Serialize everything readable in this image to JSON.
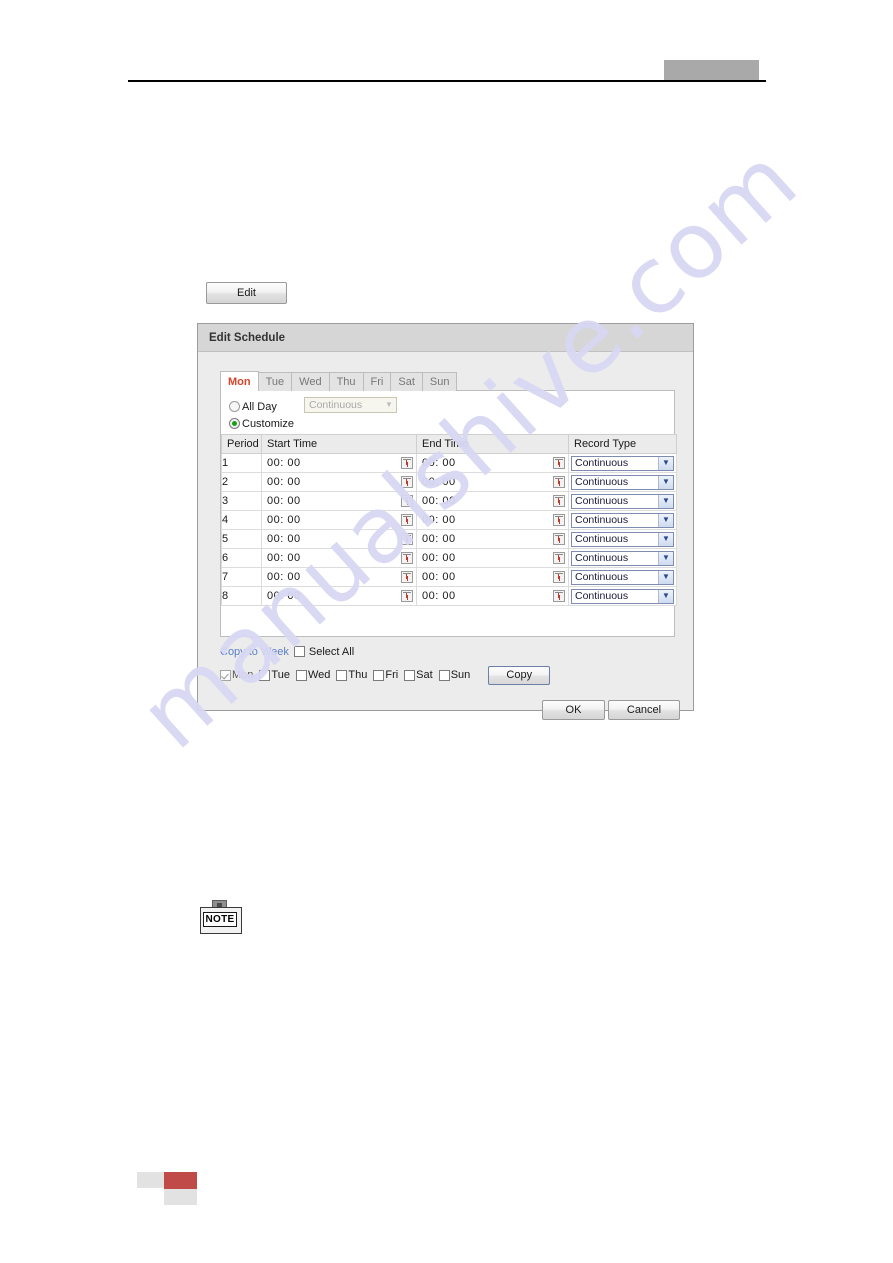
{
  "header": {
    "redaction_color": "#a9a9a9",
    "rule_color": "#000000"
  },
  "edit_button": {
    "label": "Edit"
  },
  "dialog": {
    "title": "Edit Schedule",
    "tabs": [
      {
        "label": "Mon",
        "active": true
      },
      {
        "label": "Tue",
        "active": false
      },
      {
        "label": "Wed",
        "active": false
      },
      {
        "label": "Thu",
        "active": false
      },
      {
        "label": "Fri",
        "active": false
      },
      {
        "label": "Sat",
        "active": false
      },
      {
        "label": "Sun",
        "active": false
      }
    ],
    "mode": {
      "all_day_label": "All Day",
      "customize_label": "Customize",
      "selected": "Customize",
      "all_day_record_type": "Continuous",
      "all_day_record_type_disabled": true
    },
    "table": {
      "columns": [
        "Period",
        "Start Time",
        "End Time",
        "Record Type"
      ],
      "rows": [
        {
          "period": "1",
          "start_time": "00: 00",
          "end_time": "00: 00",
          "record_type": "Continuous"
        },
        {
          "period": "2",
          "start_time": "00: 00",
          "end_time": "00: 00",
          "record_type": "Continuous"
        },
        {
          "period": "3",
          "start_time": "00: 00",
          "end_time": "00: 00",
          "record_type": "Continuous"
        },
        {
          "period": "4",
          "start_time": "00: 00",
          "end_time": "00: 00",
          "record_type": "Continuous"
        },
        {
          "period": "5",
          "start_time": "00: 00",
          "end_time": "00: 00",
          "record_type": "Continuous"
        },
        {
          "period": "6",
          "start_time": "00: 00",
          "end_time": "00: 00",
          "record_type": "Continuous"
        },
        {
          "period": "7",
          "start_time": "00: 00",
          "end_time": "00: 00",
          "record_type": "Continuous"
        },
        {
          "period": "8",
          "start_time": "00: 00",
          "end_time": "00: 00",
          "record_type": "Continuous"
        }
      ]
    },
    "copy": {
      "copy_to_week_label": "Copy to Week",
      "select_all_label": "Select All",
      "select_all_checked": false,
      "days": [
        {
          "label": "Mon",
          "checked": true,
          "disabled": true
        },
        {
          "label": "Tue",
          "checked": false,
          "disabled": false
        },
        {
          "label": "Wed",
          "checked": false,
          "disabled": false
        },
        {
          "label": "Thu",
          "checked": false,
          "disabled": false
        },
        {
          "label": "Fri",
          "checked": false,
          "disabled": false
        },
        {
          "label": "Sat",
          "checked": false,
          "disabled": false
        },
        {
          "label": "Sun",
          "checked": false,
          "disabled": false
        }
      ],
      "copy_button_label": "Copy"
    },
    "footer": {
      "ok_label": "OK",
      "cancel_label": "Cancel"
    }
  },
  "note": {
    "label": "NOTE"
  },
  "watermark": {
    "text": "manualshive.com",
    "color": "#d8d8f4"
  },
  "footer_marks": {
    "gray_color": "#e2e2e2",
    "red_color": "#c04a47"
  }
}
